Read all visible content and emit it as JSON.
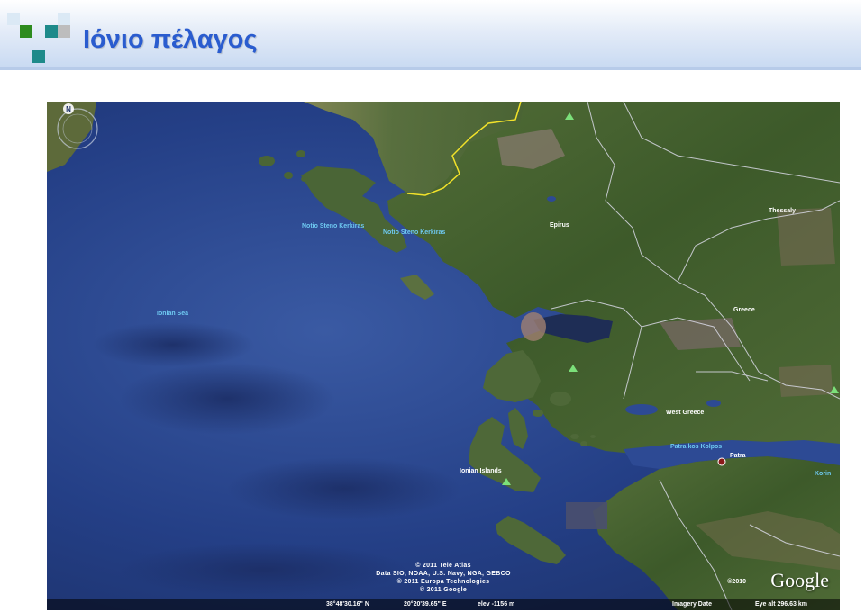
{
  "slide": {
    "title": "Ιόνιο πέλαγος"
  },
  "map": {
    "labels": {
      "ionian_sea": "Ionian Sea",
      "strait_1": "Notio Steno Kerkiras",
      "strait_2": "Notio Steno Kerkiras",
      "epirus": "Epirus",
      "thessaly": "Thessaly",
      "greece": "Greece",
      "west_greece": "West Greece",
      "patraikos": "Patraikos Kolpos",
      "patra": "Patra",
      "ionian_islands": "Ionian Islands",
      "korinth": "Korin"
    },
    "credits": [
      "© 2011 Tele Atlas",
      "Data SIO, NOAA, U.S. Navy, NGA, GEBCO",
      "© 2011 Europa Technologies",
      "© 2011 Google"
    ],
    "google_year": "©2010",
    "google_logo": "Google",
    "status": {
      "lat": "38°48'30.16\" N",
      "lon": "20°20'39.65\" E",
      "elev": "elev -1156 m",
      "imagery": "Imagery Date",
      "eye_alt": "Eye alt  296.63 km"
    },
    "compass_north": "N",
    "colors": {
      "sea": "#243f86",
      "land": "#3e5a2a",
      "border": "#d9d9e6",
      "albania_border": "#f2e22a"
    }
  }
}
